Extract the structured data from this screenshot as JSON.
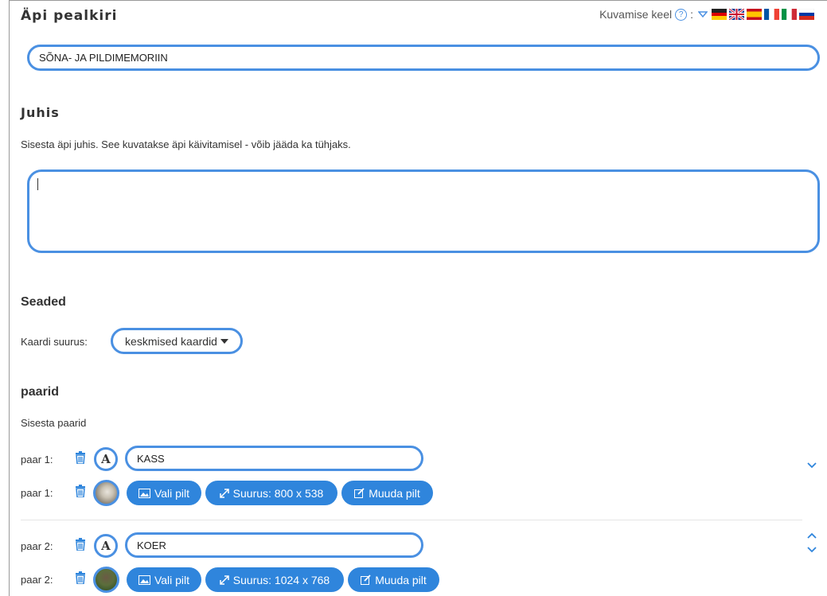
{
  "header": {
    "title": "Äpi pealkiri",
    "lang_label": "Kuvamise keel",
    "lang_sep": ":"
  },
  "title_input": {
    "value": "SÕNA- JA PILDIMEMORIIN"
  },
  "juhis": {
    "heading": "Juhis",
    "hint": "Sisesta äpi juhis. See kuvatakse äpi käivitamisel - võib jääda ka tühjaks.",
    "value": ""
  },
  "settings": {
    "heading": "Seaded",
    "card_size_label": "Kaardi suurus:",
    "card_size_value": "keskmised kaardid"
  },
  "pairs": {
    "heading": "paarid",
    "hint": "Sisesta paarid",
    "items": [
      {
        "label_text": "paar 1:",
        "text_value": "KASS",
        "label_image": "paar 1:",
        "choose_label": "Vali pilt",
        "size_label": "Suurus: 800 x 538",
        "edit_label": "Muuda pilt"
      },
      {
        "label_text": "paar 2:",
        "text_value": "KOER",
        "label_image": "paar 2:",
        "choose_label": "Vali pilt",
        "size_label": "Suurus: 1024 x 768",
        "edit_label": "Muuda pilt"
      }
    ]
  },
  "colors": {
    "accent": "#4a90e2",
    "button": "#2f85dc"
  },
  "icons": [
    "help-icon",
    "dropdown-arrow-icon",
    "flag-de-icon",
    "flag-gb-icon",
    "flag-es-icon",
    "flag-fr-icon",
    "flag-it-icon",
    "flag-ru-icon",
    "trash-icon",
    "text-a-icon",
    "image-icon",
    "resize-icon",
    "edit-icon",
    "chevron-down-icon",
    "chevron-up-icon"
  ]
}
